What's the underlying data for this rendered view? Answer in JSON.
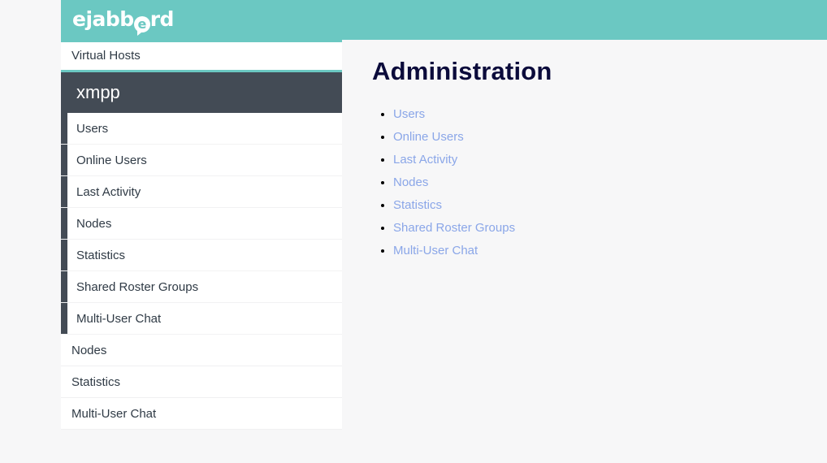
{
  "header": {
    "logo_text_pre": "ejabb",
    "logo_bubble_letter": "e",
    "logo_text_post": "rd",
    "logo_full": "ejabberd",
    "brand_color": "#6bc8c2"
  },
  "sidebar": {
    "virtual_hosts_label": "Virtual Hosts",
    "host": {
      "name": "xmpp",
      "items": [
        {
          "label": "Users"
        },
        {
          "label": "Online Users"
        },
        {
          "label": "Last Activity"
        },
        {
          "label": "Nodes"
        },
        {
          "label": "Statistics"
        },
        {
          "label": "Shared Roster Groups"
        },
        {
          "label": "Multi-User Chat"
        }
      ]
    },
    "global_items": [
      {
        "label": "Nodes"
      },
      {
        "label": "Statistics"
      },
      {
        "label": "Multi-User Chat"
      }
    ],
    "accent_color": "#434b55"
  },
  "main": {
    "title": "Administration",
    "link_color": "#8aa6e8",
    "links": [
      {
        "label": "Users"
      },
      {
        "label": "Online Users"
      },
      {
        "label": "Last Activity"
      },
      {
        "label": "Nodes"
      },
      {
        "label": "Statistics"
      },
      {
        "label": "Shared Roster Groups"
      },
      {
        "label": "Multi-User Chat"
      }
    ]
  }
}
